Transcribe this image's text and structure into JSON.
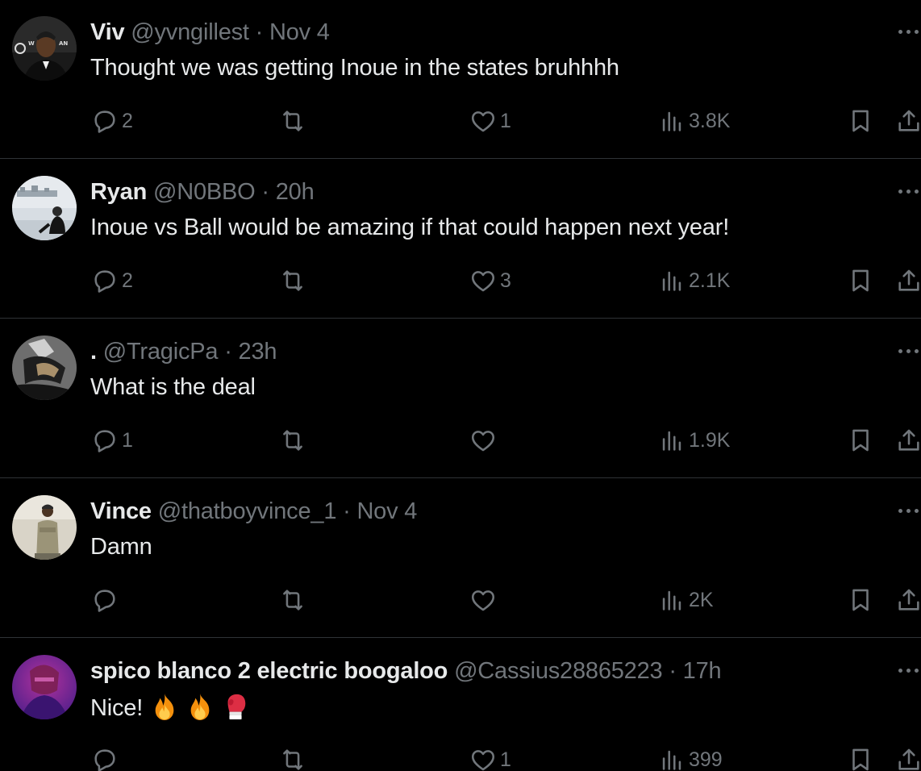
{
  "tweets": [
    {
      "name": "Viv",
      "handle": "@yvngillest",
      "separator": "·",
      "time": "Nov 4",
      "text": "Thought we was getting Inoue in the states bruhhhh",
      "replies": "2",
      "reposts": "",
      "likes": "1",
      "views": "3.8K"
    },
    {
      "name": "Ryan",
      "handle": "@N0BBO",
      "separator": "·",
      "time": "20h",
      "text": "Inoue vs Ball would be amazing if that could happen next year!",
      "replies": "2",
      "reposts": "",
      "likes": "3",
      "views": "2.1K"
    },
    {
      "name": ".",
      "handle": "@TragicPa",
      "separator": "·",
      "time": "23h",
      "text": "What is the deal",
      "replies": "1",
      "reposts": "",
      "likes": "",
      "views": "1.9K"
    },
    {
      "name": "Vince",
      "handle": "@thatboyvince_1",
      "separator": "·",
      "time": "Nov 4",
      "text": "Damn",
      "replies": "",
      "reposts": "",
      "likes": "",
      "views": "2K"
    },
    {
      "name": "spico blanco 2 electric boogaloo",
      "handle": "@Cassius28865223",
      "separator": "·",
      "time": "17h",
      "text": "Nice!",
      "emojis": [
        "fire-emoji",
        "fire-emoji",
        "boxing-glove-emoji"
      ],
      "replies": "",
      "reposts": "",
      "likes": "1",
      "views": "399"
    }
  ],
  "icons": {
    "reply": "reply-icon",
    "repost": "repost-icon",
    "like": "like-icon",
    "views": "views-icon",
    "bookmark": "bookmark-icon",
    "share": "share-icon",
    "more": "more-icon"
  },
  "colors": {
    "background": "#000000",
    "text_primary": "#e7e9ea",
    "text_secondary": "#71767b",
    "divider": "#2f3336"
  }
}
